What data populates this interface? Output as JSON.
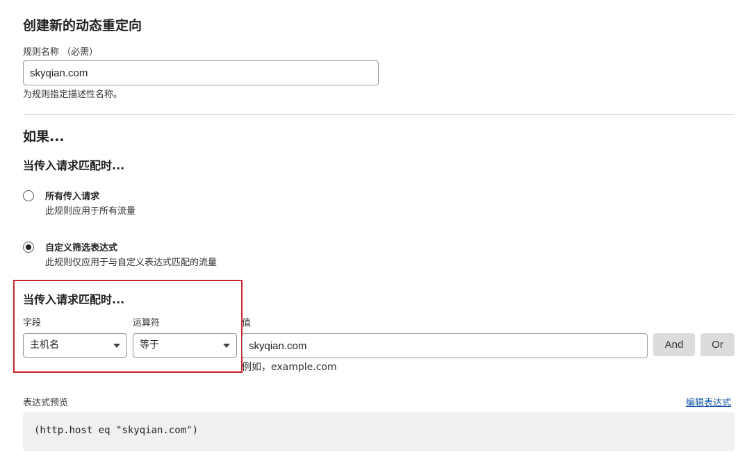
{
  "form": {
    "title": "创建新的动态重定向",
    "rule_name": {
      "label": "规则名称 （必需）",
      "value": "skyqian.com",
      "help": "为规则指定描述性名称。"
    }
  },
  "condition": {
    "if_heading": "如果...",
    "match_heading": "当传入请求匹配时...",
    "options": [
      {
        "title": "所有传入请求",
        "desc": "此规则应用于所有流量",
        "selected": false
      },
      {
        "title": "自定义筛选表达式",
        "desc": "此规则仅应用于与自定义表达式匹配的流量",
        "selected": true
      }
    ]
  },
  "expression": {
    "heading": "当传入请求匹配时...",
    "field_label": "字段",
    "field_value": "主机名",
    "operator_label": "运算符",
    "operator_value": "等于",
    "value_label": "值",
    "value": "skyqian.com",
    "value_hint": "例如，example.com",
    "and_label": "And",
    "or_label": "Or"
  },
  "preview": {
    "label": "表达式预览",
    "edit_link": "编辑表达式",
    "code": "(http.host eq \"skyqian.com\")"
  },
  "colors": {
    "highlight_border": "#c8262e",
    "link": "#1557a6",
    "button_bg": "#dcdcdc",
    "preview_bg": "#f0f0f0"
  }
}
